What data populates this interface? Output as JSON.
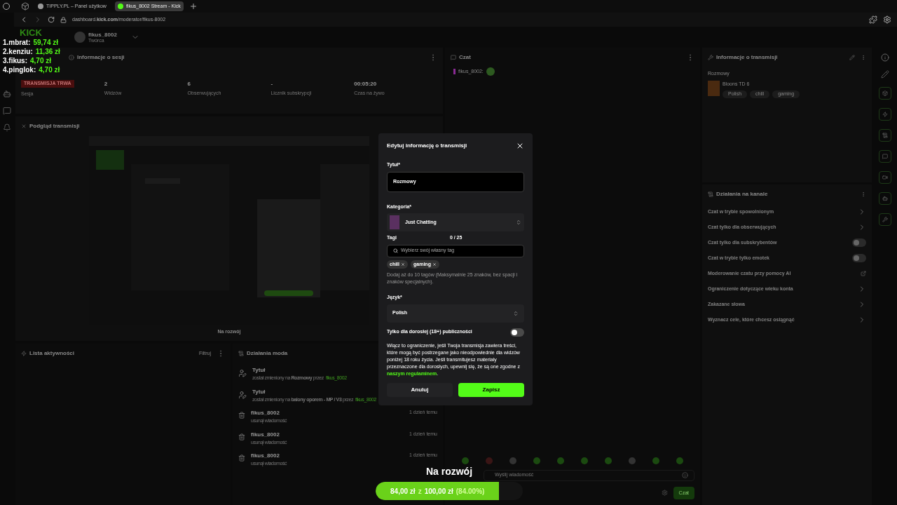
{
  "browser": {
    "tabs": [
      {
        "title": "TIPPLY.PL – Panel użytkow",
        "selected": false
      },
      {
        "title": "fikus_8002 Stream - Kick",
        "selected": true
      }
    ],
    "url": "dashboard.**kick.com**/moderator/fikus-8002"
  },
  "header": {
    "logo": "KICK",
    "user": "fikus_8002",
    "role": "Twórca"
  },
  "leaderboard": [
    {
      "label": "1.mbrat:",
      "amount": "59,74 zł"
    },
    {
      "label": "2.kenziu:",
      "amount": "11,36 zł"
    },
    {
      "label": "3.fikus:",
      "amount": "4,70 zł"
    },
    {
      "label": "4.pinglok:",
      "amount": "4,70 zł"
    }
  ],
  "session": {
    "title": "Informacje o sesji",
    "badge": "TRANSMISJA TRWA",
    "stats": [
      {
        "label": "Sesja"
      },
      {
        "value": "2",
        "label": "Widzów"
      },
      {
        "value": "6",
        "label": "Obserwujących"
      },
      {
        "value": "-",
        "label": "Licznik subskrypcji"
      },
      {
        "value": "00:05:20",
        "label": "Czas na żywo"
      }
    ]
  },
  "preview": {
    "title": "Podgląd transmisji",
    "caption": "Na rozwój"
  },
  "activity": {
    "title": "Lista aktywności",
    "filter": "Filtruj"
  },
  "mod_actions": {
    "title": "Działania moda",
    "items": [
      {
        "kind": "title",
        "name": "Tytuł",
        "text": "został zmieniony na **Rozmowy** przez",
        "user": "fikus_8002"
      },
      {
        "kind": "title",
        "name": "Tytuł",
        "text": "został zmieniony na **balony oporem - MP / V3** przez",
        "user": "fikus_8002"
      },
      {
        "kind": "delete",
        "name": "fikus_8002",
        "text": "usunął wiadomość",
        "time": "1 dzień temu"
      },
      {
        "kind": "delete",
        "name": "fikus_8002",
        "text": "usunął wiadomość",
        "time": "1 dzień temu"
      },
      {
        "kind": "delete",
        "name": "fikus_8002",
        "text": "usunął wiadomość",
        "time": "1 dzień temu"
      }
    ]
  },
  "chat": {
    "title": "Czat",
    "messages": [
      {
        "user": "fikus_8002:"
      }
    ],
    "input_placeholder": "Wyślij wiadomość",
    "send": "Czat"
  },
  "stream_info": {
    "title": "Informacje o transmisji",
    "stream_title": "Rozmowy",
    "category": "Bloons TD 6",
    "tags": [
      "Polish",
      "chill",
      "gaming"
    ]
  },
  "channel_actions": {
    "title": "Działania na kanale",
    "items": [
      {
        "kind": "arrow",
        "label": "Czat w trybie spowolnionym"
      },
      {
        "kind": "arrow",
        "label": "Czat tylko dla obserwujących"
      },
      {
        "kind": "toggle",
        "label": "Czat tylko dla subskrybentów",
        "on": false
      },
      {
        "kind": "toggle",
        "label": "Czat w trybie tylko emotek",
        "on": false
      },
      {
        "kind": "external",
        "label": "Moderowanie czatu przy pomocy AI"
      },
      {
        "kind": "arrow",
        "label": "Ograniczenie dotyczące wieku konta"
      },
      {
        "kind": "arrow",
        "label": "Zakazane słowa"
      },
      {
        "kind": "arrow",
        "label": "Wyznacz cele, które chcesz osiągnąć"
      }
    ]
  },
  "modal": {
    "title": "Edytuj informację o transmisji",
    "title_label": "Tytuł*",
    "title_value": "Rozmowy",
    "category_label": "Kategoria*",
    "category": "Just Chatting",
    "tags_label": "Tagi",
    "tags_count": "0 / 25",
    "tags_placeholder": "Wybierz swój własny tag",
    "tags": [
      "chill",
      "gaming"
    ],
    "tags_hint": "Dodaj aż do 10 tagów (Maksymalnie 25 znaków, bez spacji i znaków specjalnych).",
    "language_label": "Język*",
    "language": "Polish",
    "mature": {
      "label": "Tylko dla dorosłej (18+) publiczności",
      "on": false
    },
    "mature_hint": "Włącz to ograniczenie, jeśli Twoja transmisja zawiera treści, które mogą być postrzegane jako nieodpowiednie dla widzów poniżej 18 roku życia. Jeśli transmitujesz materiały przeznaczone dla dorosłych, upewnij się, że są one zgodne z",
    "mature_link": "naszym regulaminem",
    "mature_end": ".",
    "cancel": "Anuluj",
    "save": "Zapisz"
  },
  "goal": {
    "title": "Na rozwój",
    "current": "84,00 zł",
    "separator": "z",
    "target": "100,00 zł",
    "percent": "(84.00%)",
    "level": 0.84
  }
}
